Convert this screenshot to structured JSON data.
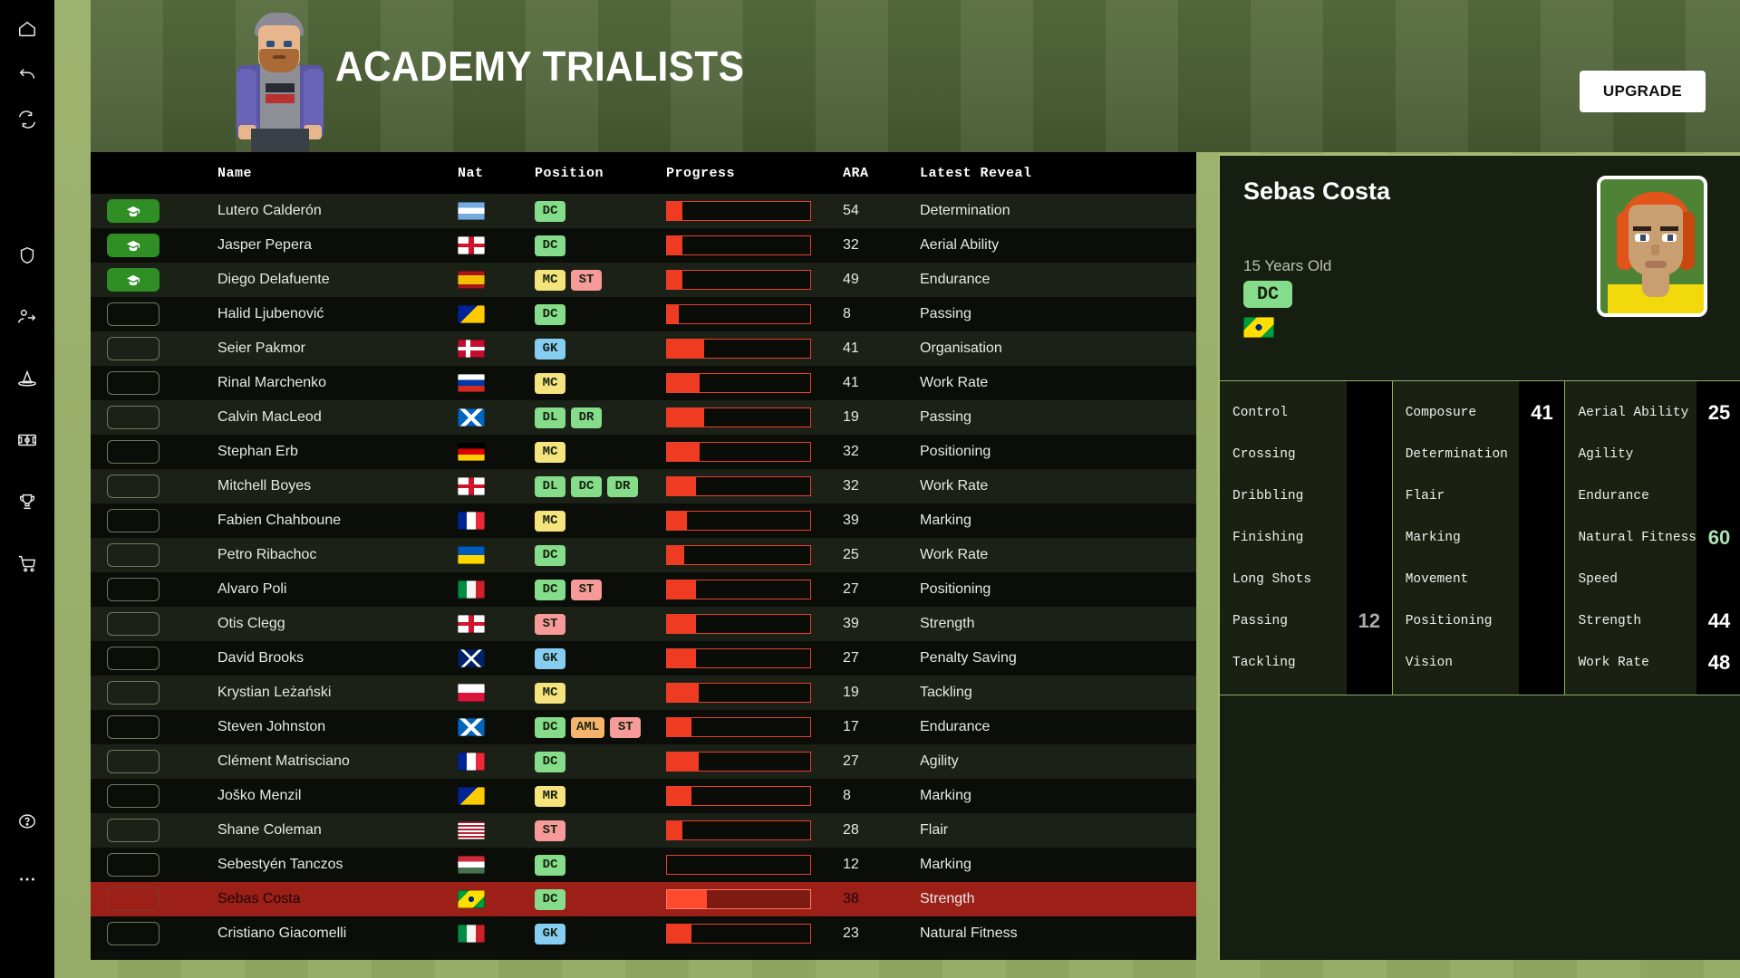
{
  "header": {
    "title": "ACADEMY TRIALISTS",
    "upgrade_label": "UPGRADE",
    "manager_alt": "manager-avatar"
  },
  "sidebar": {
    "items": [
      {
        "name": "home-icon",
        "label": "Home"
      },
      {
        "name": "back-icon",
        "label": "Back"
      },
      {
        "name": "refresh-icon",
        "label": "Continue"
      },
      {
        "name": "shield-icon",
        "label": "Club"
      },
      {
        "name": "transfers-icon",
        "label": "Transfers"
      },
      {
        "name": "training-icon",
        "label": "Training"
      },
      {
        "name": "pitch-icon",
        "label": "Tactics"
      },
      {
        "name": "trophy-icon",
        "label": "Competitions"
      },
      {
        "name": "shop-icon",
        "label": "Shop"
      },
      {
        "name": "help-icon",
        "label": "Help"
      },
      {
        "name": "more-icon",
        "label": "More"
      }
    ]
  },
  "table": {
    "columns": [
      "",
      "Name",
      "Nat",
      "Position",
      "Progress",
      "ARA",
      "Latest Reveal"
    ],
    "rows": [
      {
        "graduated": true,
        "name": "Lutero Calderón",
        "nat": "ar",
        "positions": [
          "DC"
        ],
        "progress": 11,
        "ara": "54",
        "reveal": "Determination"
      },
      {
        "graduated": true,
        "name": "Jasper Pepera",
        "nat": "en",
        "positions": [
          "DC"
        ],
        "progress": 11,
        "ara": "32",
        "reveal": "Aerial Ability"
      },
      {
        "graduated": true,
        "name": "Diego Delafuente",
        "nat": "es",
        "positions": [
          "MC",
          "ST"
        ],
        "progress": 11,
        "ara": "49",
        "reveal": "Endurance"
      },
      {
        "graduated": false,
        "name": "Halid Ljubenović",
        "nat": "ba",
        "positions": [
          "DC"
        ],
        "progress": 8,
        "ara": "8",
        "reveal": "Passing"
      },
      {
        "graduated": false,
        "name": "Seier Pakmor",
        "nat": "dk",
        "positions": [
          "GK"
        ],
        "progress": 26,
        "ara": "41",
        "reveal": "Organisation"
      },
      {
        "graduated": false,
        "name": "Rinal Marchenko",
        "nat": "ru",
        "positions": [
          "MC"
        ],
        "progress": 23,
        "ara": "41",
        "reveal": "Work Rate"
      },
      {
        "graduated": false,
        "name": "Calvin MacLeod",
        "nat": "sc",
        "positions": [
          "DL",
          "DR"
        ],
        "progress": 26,
        "ara": "19",
        "reveal": "Passing"
      },
      {
        "graduated": false,
        "name": "Stephan Erb",
        "nat": "de",
        "positions": [
          "MC"
        ],
        "progress": 23,
        "ara": "32",
        "reveal": "Positioning"
      },
      {
        "graduated": false,
        "name": "Mitchell Boyes",
        "nat": "en",
        "positions": [
          "DL",
          "DC",
          "DR"
        ],
        "progress": 20,
        "ara": "32",
        "reveal": "Work Rate"
      },
      {
        "graduated": false,
        "name": "Fabien Chahboune",
        "nat": "fr",
        "positions": [
          "MC"
        ],
        "progress": 14,
        "ara": "39",
        "reveal": "Marking"
      },
      {
        "graduated": false,
        "name": "Petro Ribachoc",
        "nat": "ua",
        "positions": [
          "DC"
        ],
        "progress": 12,
        "ara": "25",
        "reveal": "Work Rate"
      },
      {
        "graduated": false,
        "name": "Alvaro Poli",
        "nat": "it",
        "positions": [
          "DC",
          "ST"
        ],
        "progress": 20,
        "ara": "27",
        "reveal": "Positioning"
      },
      {
        "graduated": false,
        "name": "Otis Clegg",
        "nat": "en",
        "positions": [
          "ST"
        ],
        "progress": 20,
        "ara": "39",
        "reveal": "Strength"
      },
      {
        "graduated": false,
        "name": "David Brooks",
        "nat": "au",
        "positions": [
          "GK"
        ],
        "progress": 20,
        "ara": "27",
        "reveal": "Penalty Saving"
      },
      {
        "graduated": false,
        "name": "Krystian Leżański",
        "nat": "pl",
        "positions": [
          "MC"
        ],
        "progress": 22,
        "ara": "19",
        "reveal": "Tackling"
      },
      {
        "graduated": false,
        "name": "Steven Johnston",
        "nat": "sc",
        "positions": [
          "DC",
          "AML",
          "ST"
        ],
        "progress": 17,
        "ara": "17",
        "reveal": "Endurance"
      },
      {
        "graduated": false,
        "name": "Clément Matrisciano",
        "nat": "fr",
        "positions": [
          "DC"
        ],
        "progress": 22,
        "ara": "27",
        "reveal": "Agility"
      },
      {
        "graduated": false,
        "name": "Joško Menzil",
        "nat": "ba",
        "positions": [
          "MR"
        ],
        "progress": 17,
        "ara": "8",
        "reveal": "Marking"
      },
      {
        "graduated": false,
        "name": "Shane Coleman",
        "nat": "us",
        "positions": [
          "ST"
        ],
        "progress": 11,
        "ara": "28",
        "reveal": "Flair"
      },
      {
        "graduated": false,
        "name": "Sebestyén Tanczos",
        "nat": "hu",
        "positions": [
          "DC"
        ],
        "progress": 0,
        "ara": "12",
        "reveal": "Marking"
      },
      {
        "graduated": false,
        "name": "Sebas Costa",
        "nat": "br",
        "positions": [
          "DC"
        ],
        "progress": 28,
        "ara": "38",
        "reveal": "Strength",
        "selected": true
      },
      {
        "graduated": false,
        "name": "Cristiano Giacomelli",
        "nat": "it",
        "positions": [
          "GK"
        ],
        "progress": 17,
        "ara": "23",
        "reveal": "Natural Fitness"
      }
    ]
  },
  "detail": {
    "name": "Sebas Costa",
    "age": "15 Years Old",
    "position": "DC",
    "nat": "br",
    "attribute_columns": [
      {
        "rows": [
          {
            "label": "Control",
            "value": "",
            "style": "empty"
          },
          {
            "label": "Crossing",
            "value": "",
            "style": "empty"
          },
          {
            "label": "Dribbling",
            "value": "",
            "style": "empty"
          },
          {
            "label": "Finishing",
            "value": "",
            "style": "empty"
          },
          {
            "label": "Long Shots",
            "value": "",
            "style": "empty"
          },
          {
            "label": "Passing",
            "value": "12",
            "style": "dim"
          },
          {
            "label": "Tackling",
            "value": "",
            "style": "empty"
          }
        ]
      },
      {
        "rows": [
          {
            "label": "Composure",
            "value": "41",
            "style": "white"
          },
          {
            "label": "Determination",
            "value": "",
            "style": "empty"
          },
          {
            "label": "Flair",
            "value": "",
            "style": "empty"
          },
          {
            "label": "Marking",
            "value": "",
            "style": "empty"
          },
          {
            "label": "Movement",
            "value": "",
            "style": "empty"
          },
          {
            "label": "Positioning",
            "value": "",
            "style": "empty"
          },
          {
            "label": "Vision",
            "value": "",
            "style": "empty"
          }
        ]
      },
      {
        "rows": [
          {
            "label": "Aerial Ability",
            "value": "25",
            "style": "white"
          },
          {
            "label": "Agility",
            "value": "",
            "style": "empty"
          },
          {
            "label": "Endurance",
            "value": "",
            "style": "empty"
          },
          {
            "label": "Natural Fitness",
            "value": "60",
            "style": "good"
          },
          {
            "label": "Speed",
            "value": "",
            "style": "empty"
          },
          {
            "label": "Strength",
            "value": "44",
            "style": "white"
          },
          {
            "label": "Work Rate",
            "value": "48",
            "style": "white"
          }
        ]
      }
    ]
  },
  "colors": {
    "accent_green": "#a8bd78",
    "progress_red": "#ef3b22",
    "selected_row": "#9c2018",
    "pos_def": "#85dd8b",
    "pos_mid": "#f5e37e",
    "pos_att": "#f69a9a",
    "pos_gk": "#86cdf2",
    "pos_wing": "#f6b46a"
  }
}
